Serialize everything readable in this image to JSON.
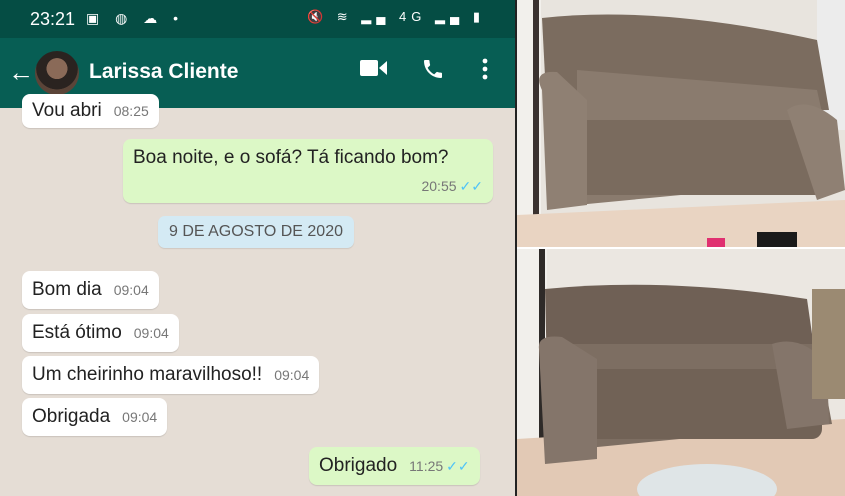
{
  "status_bar": {
    "time": "23:21",
    "left_icons": "▣ ◍ ☁ •",
    "right_icons": "🔇 ≋ ▂▄ 4G ▂▄ ▮"
  },
  "app_bar": {
    "back_icon": "back-arrow-icon",
    "contact_name": "Larissa Cliente",
    "video_icon": "video-call-icon",
    "phone_icon": "voice-call-icon",
    "menu_icon": "more-options-icon"
  },
  "messages": {
    "partial": {
      "text": "Vou abri",
      "time": "08:25"
    },
    "m1": {
      "text": "Boa noite, e o sofá? Tá ficando bom?",
      "time": "20:55",
      "ticks": "✓✓"
    },
    "date": "9 DE AGOSTO DE 2020",
    "m2": {
      "text": "Bom dia",
      "time": "09:04"
    },
    "m3": {
      "text": "Está ótimo",
      "time": "09:04"
    },
    "m4": {
      "text": "Um cheirinho maravilhoso!!",
      "time": "09:04"
    },
    "m5": {
      "text": "Obrigada",
      "time": "09:04"
    },
    "m6": {
      "text": "Obrigado",
      "time": "11:25",
      "ticks": "✓✓"
    }
  },
  "colors": {
    "header": "#075e54",
    "status": "#054d44",
    "outgoing": "#dcf8c6",
    "incoming": "#ffffff",
    "chat_bg": "#e5ddd5",
    "read_ticks": "#4fc3f7"
  }
}
